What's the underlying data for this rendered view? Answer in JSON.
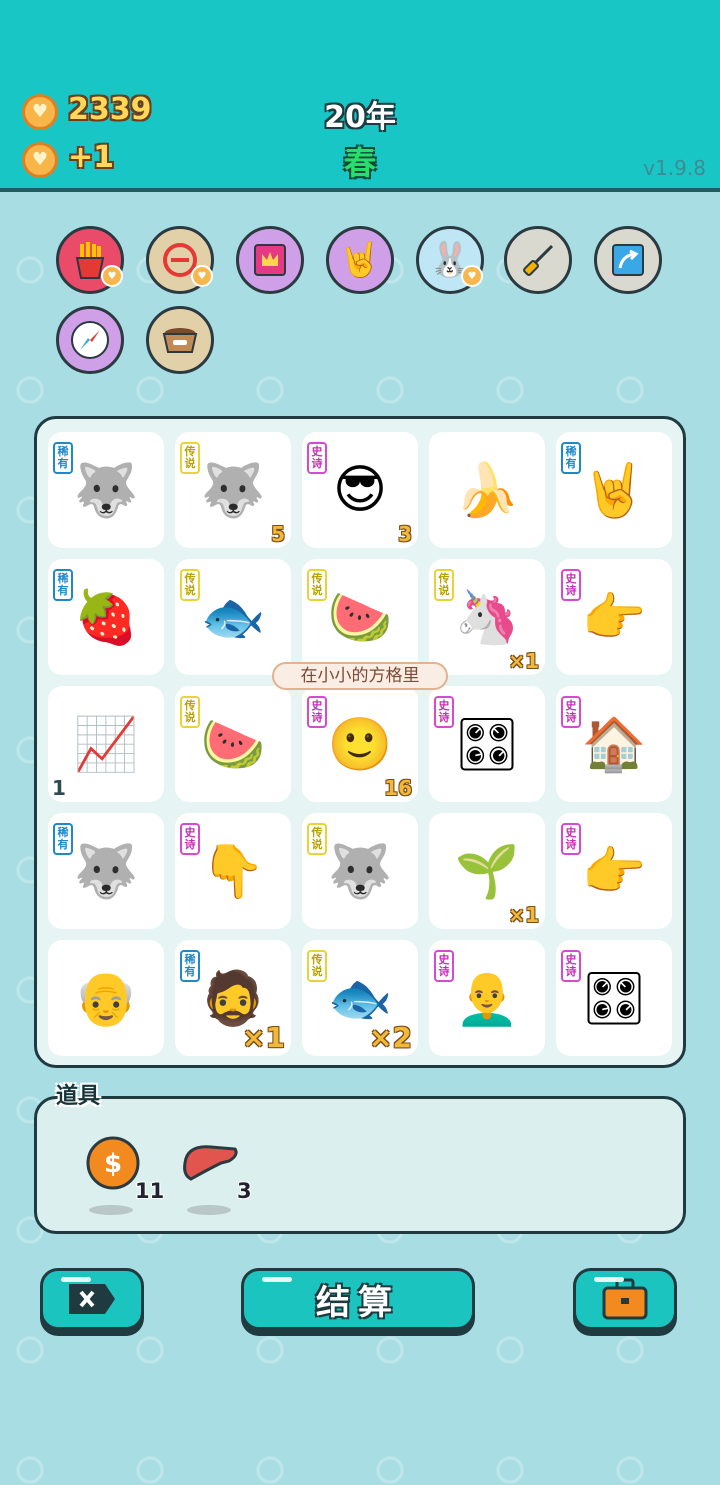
{
  "header": {
    "coins": "2339",
    "coin_income": "+1",
    "year": "20年",
    "season": "春",
    "version": "v1.9.8"
  },
  "skills": [
    {
      "icon": "fries-icon"
    },
    {
      "icon": "minus-circle-icon"
    },
    {
      "icon": "crown-box-icon"
    },
    {
      "icon": "rock-hand-icon"
    },
    {
      "icon": "bunny-icon"
    },
    {
      "icon": "screwdriver-icon"
    },
    {
      "icon": "arrow-card-icon"
    },
    {
      "icon": "compass-icon"
    },
    {
      "icon": "dog-bowl-icon"
    }
  ],
  "board": {
    "speech_bubble": "在小小的方格里",
    "cells": [
      {
        "icon": "husky-icon",
        "tag": "稀有",
        "count": ""
      },
      {
        "icon": "king-husky-icon",
        "tag": "传说",
        "count": "5"
      },
      {
        "icon": "sunglasses-man-icon",
        "tag": "史诗",
        "count": "3"
      },
      {
        "icon": "banana-icon",
        "tag": "",
        "count": ""
      },
      {
        "icon": "rock-hand-icon",
        "tag": "稀有",
        "count": ""
      },
      {
        "icon": "lychee-icon",
        "tag": "稀有",
        "count": ""
      },
      {
        "icon": "koi-fish-icon",
        "tag": "传说",
        "count": ""
      },
      {
        "icon": "watermelon-icon",
        "tag": "传说",
        "count": ""
      },
      {
        "icon": "unicorn-icon",
        "tag": "传说",
        "count": "×1"
      },
      {
        "icon": "pointing-hand-icon",
        "tag": "史诗",
        "count": ""
      },
      {
        "icon": "trend-card-icon",
        "tag": "",
        "count": "1"
      },
      {
        "icon": "watermelon-icon",
        "tag": "传说",
        "count": ""
      },
      {
        "icon": "sprout-head-icon",
        "tag": "史诗",
        "count": "16"
      },
      {
        "icon": "gpu-card-icon",
        "tag": "史诗",
        "count": ""
      },
      {
        "icon": "bunny-house-icon",
        "tag": "史诗",
        "count": ""
      },
      {
        "icon": "husky-icon",
        "tag": "稀有",
        "count": ""
      },
      {
        "icon": "pointing-down-hand-icon",
        "tag": "史诗",
        "count": ""
      },
      {
        "icon": "king-husky-icon",
        "tag": "传说",
        "count": ""
      },
      {
        "icon": "sprout-icon",
        "tag": "",
        "count": "×1"
      },
      {
        "icon": "pointing-hand-icon",
        "tag": "史诗",
        "count": ""
      },
      {
        "icon": "old-man-icon",
        "tag": "",
        "count": ""
      },
      {
        "icon": "bucket-hat-man-icon",
        "tag": "稀有",
        "count": "×1"
      },
      {
        "icon": "koi-fish-icon",
        "tag": "传说",
        "count": "×2"
      },
      {
        "icon": "bald-man-icon",
        "tag": "史诗",
        "count": ""
      },
      {
        "icon": "gpu-card-icon",
        "tag": "史诗",
        "count": ""
      }
    ]
  },
  "tools": {
    "label": "道具",
    "items": [
      {
        "icon": "coin-icon",
        "count": "11"
      },
      {
        "icon": "liver-icon",
        "count": "3"
      }
    ]
  },
  "buttons": {
    "settle_label": "结算"
  }
}
